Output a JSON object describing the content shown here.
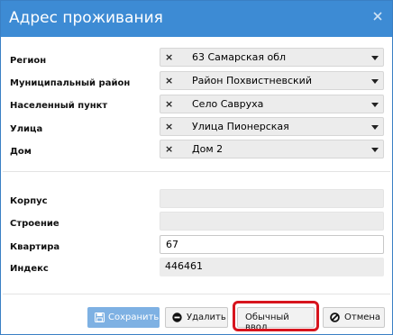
{
  "dialog": {
    "title": "Адрес проживания",
    "close_icon": "close-icon"
  },
  "address": {
    "region": {
      "label": "Регион",
      "value": "63 Самарская обл"
    },
    "district": {
      "label": "Муниципальный район",
      "value": "Район Похвистневский"
    },
    "locality": {
      "label": "Населенный пункт",
      "value": "Село Савруха"
    },
    "street": {
      "label": "Улица",
      "value": "Улица Пионерская"
    },
    "house": {
      "label": "Дом",
      "value": "Дом 2"
    },
    "clear_symbol": "×"
  },
  "details": {
    "building": {
      "label": "Корпус",
      "value": ""
    },
    "structure": {
      "label": "Строение",
      "value": ""
    },
    "apartment": {
      "label": "Квартира",
      "value": "67"
    },
    "postcode": {
      "label": "Индекс",
      "value": "446461"
    }
  },
  "footer": {
    "save_label": "Сохранить",
    "delete_label": "Удалить",
    "plain_input_label": "Обычный ввод",
    "cancel_label": "Отмена"
  },
  "colors": {
    "titlebar": "#3d8bd4",
    "save_button": "#7eb1e3",
    "highlight": "#d7141d"
  }
}
